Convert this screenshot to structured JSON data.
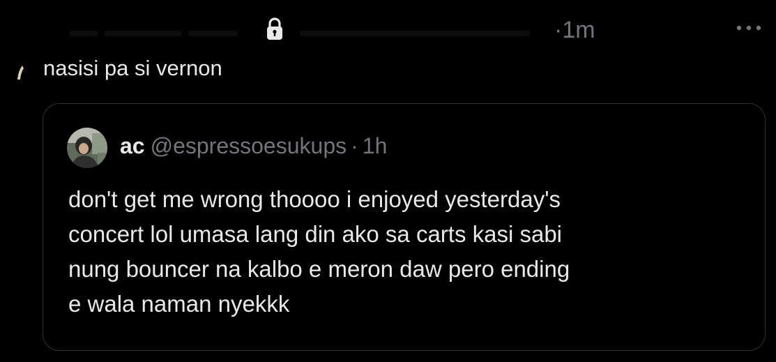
{
  "tweet": {
    "timestamp": "·1m",
    "text": "nasisi pa si vernon",
    "icons": {
      "lock": "lock-icon",
      "more": "more-horizontal-icon"
    }
  },
  "quote": {
    "display_name": "ac",
    "handle": "@espressoesukups",
    "separator": "·",
    "time": "1h",
    "body_lines": [
      "don't get me wrong thoooo i enjoyed yesterday's",
      "concert lol umasa lang din ako sa carts kasi sabi",
      "nung bouncer na kalbo e meron daw pero ending",
      "e wala naman nyekkk"
    ]
  },
  "colors": {
    "background": "#000000",
    "text_primary": "#e7e9ea",
    "text_secondary": "#71767b",
    "border": "#2f3336"
  }
}
